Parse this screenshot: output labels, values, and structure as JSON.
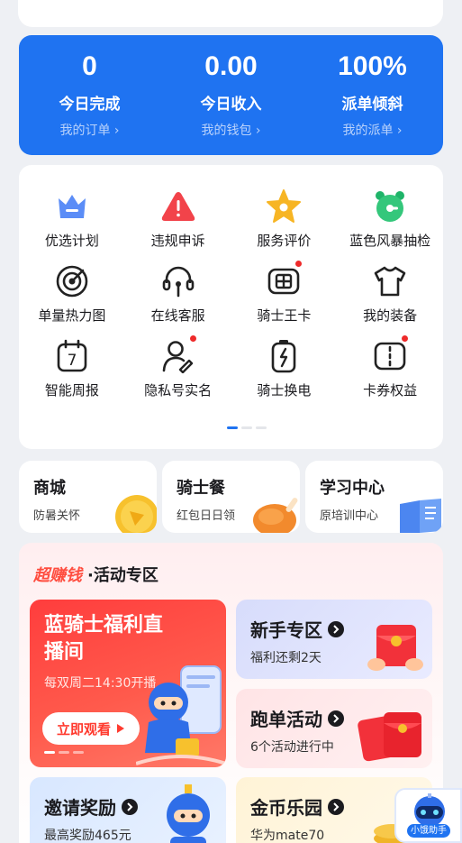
{
  "stats": [
    {
      "value": "0",
      "label": "今日完成",
      "link": "我的订单 ›"
    },
    {
      "value": "0.00",
      "label": "今日收入",
      "link": "我的钱包 ›"
    },
    {
      "value": "100%",
      "label": "派单倾斜",
      "link": "我的派单 ›"
    }
  ],
  "grid": {
    "items": [
      {
        "label": "优选计划",
        "icon": "crown-icon"
      },
      {
        "label": "违规申诉",
        "icon": "warning-icon"
      },
      {
        "label": "服务评价",
        "icon": "star-icon"
      },
      {
        "label": "蓝色风暴抽检",
        "icon": "alarm-clock-icon"
      },
      {
        "label": "单量热力图",
        "icon": "target-icon"
      },
      {
        "label": "在线客服",
        "icon": "headset-icon"
      },
      {
        "label": "骑士王卡",
        "icon": "sim-card-icon",
        "badge": true
      },
      {
        "label": "我的装备",
        "icon": "shirt-icon"
      },
      {
        "label": "智能周报",
        "icon": "calendar-icon",
        "day": "7"
      },
      {
        "label": "隐私号实名",
        "icon": "user-verify-icon",
        "badge": true
      },
      {
        "label": "骑士换电",
        "icon": "battery-icon"
      },
      {
        "label": "卡券权益",
        "icon": "coupon-icon",
        "badge": true
      }
    ]
  },
  "shortcuts": [
    {
      "title": "商城",
      "sub": "防暑关怀"
    },
    {
      "title": "骑士餐",
      "sub": "红包日日领"
    },
    {
      "title": "学习中心",
      "sub": "原培训中心"
    }
  ],
  "activity": {
    "brand": "超赚钱",
    "title": "·活动专区",
    "live": {
      "title": "蓝骑士福利直播间",
      "sub": "每双周二14:30开播",
      "button": "立即观看"
    },
    "tiles": [
      {
        "title": "新手专区",
        "sub": "福利还剩2天"
      },
      {
        "title": "跑单活动",
        "sub": "6个活动进行中"
      },
      {
        "title": "邀请奖励",
        "sub": "最高奖励465元"
      },
      {
        "title": "金币乐园",
        "sub": "华为mate70"
      }
    ]
  },
  "helper": {
    "label": "小饿助手"
  },
  "colors": {
    "primary": "#1f73f1",
    "danger": "#ee2a2a",
    "activity": "#ff4d3f"
  }
}
